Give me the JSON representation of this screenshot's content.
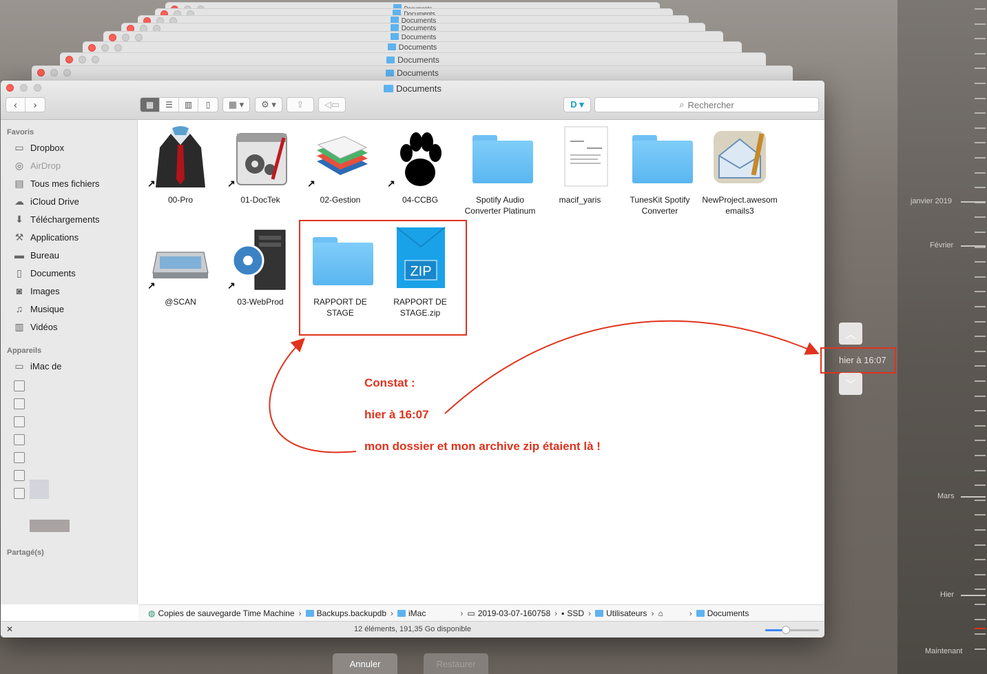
{
  "window": {
    "title": "Documents",
    "stack_title": "Documents"
  },
  "toolbar": {
    "search_placeholder": "Rechercher"
  },
  "sidebar": {
    "favorites_heading": "Favoris",
    "favorites": [
      {
        "label": "Dropbox",
        "icon": "folder-icon"
      },
      {
        "label": "AirDrop",
        "icon": "airdrop-icon"
      },
      {
        "label": "Tous mes fichiers",
        "icon": "all-files-icon"
      },
      {
        "label": "iCloud Drive",
        "icon": "cloud-icon"
      },
      {
        "label": "Téléchargements",
        "icon": "download-icon"
      },
      {
        "label": "Applications",
        "icon": "applications-icon"
      },
      {
        "label": "Bureau",
        "icon": "desktop-icon"
      },
      {
        "label": "Documents",
        "icon": "document-icon"
      },
      {
        "label": "Images",
        "icon": "camera-icon"
      },
      {
        "label": "Musique",
        "icon": "music-icon"
      },
      {
        "label": "Vidéos",
        "icon": "film-icon"
      }
    ],
    "devices_heading": "Appareils",
    "device_label": "iMac de",
    "shared_heading": "Partagé(s)"
  },
  "files": [
    {
      "name": "00-Pro",
      "kind": "suit"
    },
    {
      "name": "01-DocTek",
      "kind": "gears"
    },
    {
      "name": "02-Gestion",
      "kind": "stack"
    },
    {
      "name": "04-CCBG",
      "kind": "paw"
    },
    {
      "name": "Spotify Audio Converter Platinum",
      "kind": "folder"
    },
    {
      "name": "macif_yaris",
      "kind": "doc"
    },
    {
      "name": "TunesKit Spotify Converter",
      "kind": "folder"
    },
    {
      "name": "NewProject.awesomemails3",
      "kind": "mail"
    },
    {
      "name": "@SCAN",
      "kind": "scanner"
    },
    {
      "name": "03-WebProd",
      "kind": "server"
    },
    {
      "name": "RAPPORT DE STAGE",
      "kind": "folder"
    },
    {
      "name": "RAPPORT DE STAGE.zip",
      "kind": "zip"
    }
  ],
  "zip_badge": "ZIP",
  "pathbar": {
    "crumbs": [
      "Copies de sauvegarde Time Machine",
      "Backups.backupdb",
      "iMac",
      "2019-03-07-160758",
      "SSD",
      "Utilisateurs",
      "",
      "Documents"
    ]
  },
  "status": {
    "text": "12 éléments, 191,35 Go disponible",
    "zoom_level": 0.38
  },
  "buttons": {
    "cancel": "Annuler",
    "restore": "Restaurer"
  },
  "timeline": {
    "current": "hier à 16:07",
    "labels": [
      "janvier 2019",
      "Février",
      "Mars",
      "Hier",
      "Maintenant"
    ]
  },
  "annotation": {
    "line1": "Constat :",
    "line2": "hier à 16:07",
    "line3": "mon dossier et mon archive zip étaient là !"
  },
  "colors": {
    "annotation": "#e0331e",
    "folder": "#5ab6f0",
    "close": "#fc5f57"
  }
}
